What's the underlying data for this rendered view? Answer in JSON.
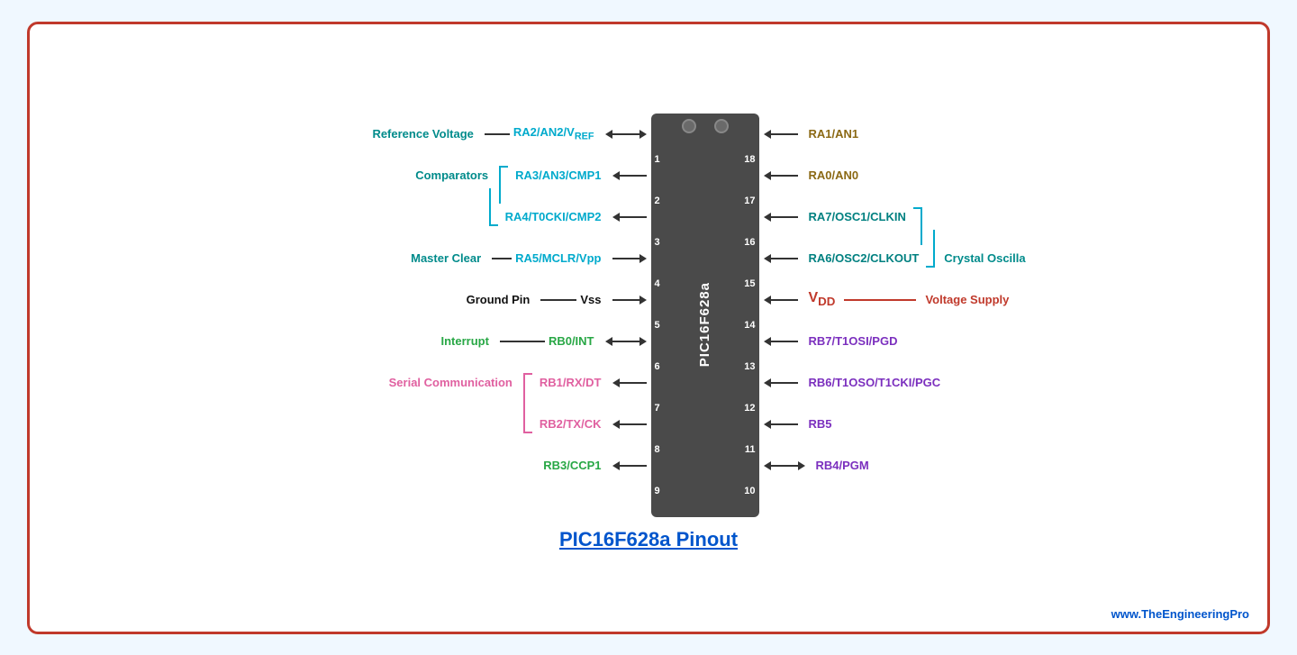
{
  "title": "PIC16F628a Pinout",
  "chip_label": "PIC16F628a",
  "website": "www.TheEngineeringPro",
  "left_pins": [
    {
      "num": "1",
      "pin_label": "RA2/AN2/V",
      "pin_sub": "REF",
      "pin_color": "cyan",
      "func_label": "Reference Voltage",
      "func_color": "dark-cyan",
      "arrow": "double",
      "connector": "line"
    },
    {
      "num": "2",
      "pin_label": "RA3/AN3/CMP1",
      "pin_color": "cyan",
      "func_label": "Comparators",
      "func_color": "dark-cyan",
      "arrow": "left",
      "bracket_top": true
    },
    {
      "num": "3",
      "pin_label": "RA4/T0CKI/CMP2",
      "pin_color": "cyan",
      "arrow": "left",
      "bracket_bottom": true
    },
    {
      "num": "4",
      "pin_label": "RA5/MCLR/Vpp",
      "pin_color": "cyan",
      "func_label": "Master Clear",
      "func_color": "dark-cyan",
      "arrow": "right",
      "connector": "line"
    },
    {
      "num": "5",
      "pin_label": "Vss",
      "pin_color": "black",
      "func_label": "Ground Pin",
      "func_color": "black",
      "arrow": "right",
      "connector": "line"
    },
    {
      "num": "6",
      "pin_label": "RB0/INT",
      "pin_color": "green",
      "func_label": "Interrupt",
      "func_color": "green",
      "arrow": "double",
      "connector": "line"
    },
    {
      "num": "7",
      "pin_label": "RB1/RX/DT",
      "pin_color": "pink",
      "func_label": "Serial Communication",
      "func_color": "pink",
      "arrow": "left",
      "bracket_top": true
    },
    {
      "num": "8",
      "pin_label": "RB2/TX/CK",
      "pin_color": "pink",
      "arrow": "left",
      "bracket_bottom": true
    },
    {
      "num": "9",
      "pin_label": "RB3/CCP1",
      "pin_color": "green",
      "arrow": "left"
    }
  ],
  "right_pins": [
    {
      "num": "18",
      "pin_label": "RA1/AN1",
      "pin_color": "brown",
      "arrow": "left"
    },
    {
      "num": "17",
      "pin_label": "RA0/AN0",
      "pin_color": "brown",
      "arrow": "left"
    },
    {
      "num": "16",
      "pin_label": "RA7/OSC1/CLKIN",
      "pin_color": "teal",
      "arrow": "left",
      "bracket_top": true
    },
    {
      "num": "15",
      "pin_label": "RA6/OSC2/CLKOUT",
      "pin_color": "teal",
      "arrow": "left",
      "bracket_bottom": true,
      "func_label": "Crystal Oscilla",
      "func_color": "dark-cyan"
    },
    {
      "num": "14",
      "pin_label": "VDD",
      "pin_label_sub": "DD",
      "pin_color": "red",
      "func_label": "Voltage Supply",
      "func_color": "red",
      "arrow": "line"
    },
    {
      "num": "13",
      "pin_label": "RB7/T1OSI/PGD",
      "pin_color": "purple",
      "arrow": "left"
    },
    {
      "num": "12",
      "pin_label": "RB6/T1OSO/T1CKI/PGC",
      "pin_color": "purple",
      "arrow": "left"
    },
    {
      "num": "11",
      "pin_label": "RB5",
      "pin_color": "purple",
      "arrow": "left"
    },
    {
      "num": "10",
      "pin_label": "RB4/PGM",
      "pin_color": "purple",
      "arrow": "double"
    }
  ]
}
